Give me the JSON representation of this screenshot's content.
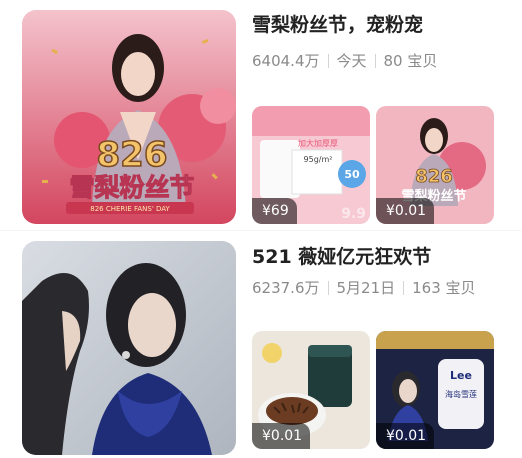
{
  "items": [
    {
      "title": "雪梨粉丝节，宠粉宠",
      "views": "6404.4万",
      "date": "今天",
      "count": "80 宝贝",
      "cover_text": {
        "num": "826",
        "name": "雪梨粉丝节",
        "sub": "826 CHERIE FANS' DAY"
      },
      "thumbs": [
        {
          "price": "¥69",
          "ghost": "9.9",
          "text": [
            "加大加厚厚",
            "95g/m²",
            "50"
          ]
        },
        {
          "price": "¥0.01",
          "ghost": "",
          "text": [
            "826",
            "雪梨粉丝节"
          ]
        }
      ]
    },
    {
      "title": "521 薇娅亿元狂欢节",
      "views": "6237.6万",
      "date": "5月21日",
      "count": "163 宝贝",
      "thumbs": [
        {
          "price": "¥0.01",
          "ghost": "",
          "text": []
        },
        {
          "price": "¥0.01",
          "ghost": "",
          "text": [
            "Lee",
            "海岛雪莲"
          ]
        }
      ]
    }
  ],
  "colors": {
    "pink": "#e9597a",
    "pink_light": "#f3b9c4",
    "gold": "#e7b04f",
    "navy": "#1f2d78"
  }
}
